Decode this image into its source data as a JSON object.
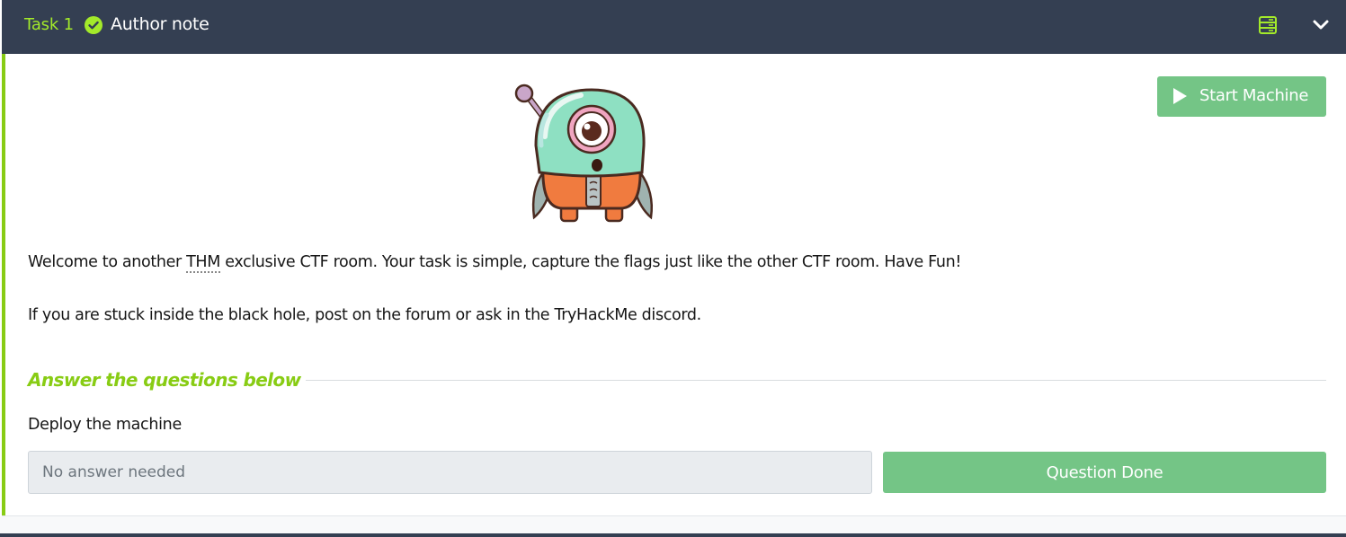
{
  "task": {
    "number_label": "Task 1",
    "title": "Author note",
    "status": "completed",
    "icons": [
      "check-circle-icon",
      "server-icon",
      "chevron-down-icon"
    ]
  },
  "machine": {
    "start_label": "Start Machine"
  },
  "content": {
    "paragraph1": {
      "before": "Welcome to another ",
      "abbr": "THM",
      "after": " exclusive CTF room. Your task is simple, capture the flags just like the other CTF room. Have Fun!"
    },
    "paragraph2": "If you are stuck inside the black hole, post on the forum or ask in the TryHackMe discord."
  },
  "questions": {
    "heading": "Answer the questions below",
    "items": [
      {
        "text": "Deploy the machine",
        "answer_placeholder": "No answer needed",
        "button_label": "Question Done"
      }
    ]
  },
  "colors": {
    "header_bg": "#343f52",
    "accent_green": "#88cc14",
    "button_green": "#74c586"
  }
}
